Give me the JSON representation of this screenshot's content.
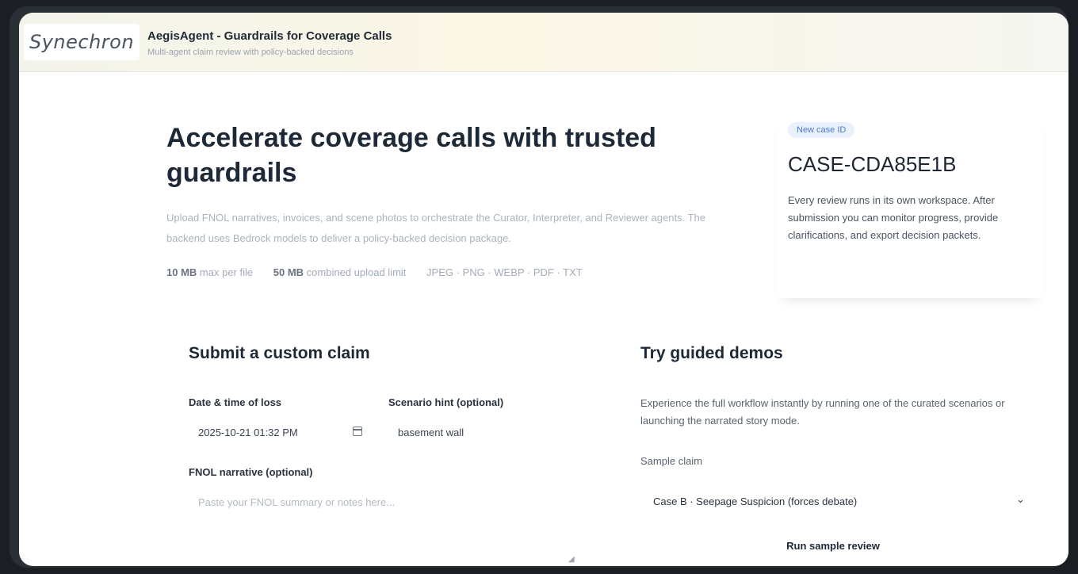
{
  "header": {
    "logo_text": "Synechron",
    "title": "AegisAgent - Guardrails for Coverage Calls",
    "subtitle": "Multi-agent claim review with policy-backed decisions"
  },
  "hero": {
    "title": "Accelerate coverage calls with trusted guardrails",
    "description": "Upload FNOL narratives, invoices, and scene photos to orchestrate the Curator, Interpreter, and Reviewer agents. The backend uses Bedrock models to deliver a policy-backed decision package.",
    "limit_file_value": "10 MB",
    "limit_file_text": "max per file",
    "limit_total_value": "50 MB",
    "limit_total_text": "combined upload limit",
    "formats": "JPEG · PNG · WEBP · PDF · TXT"
  },
  "case": {
    "badge": "New case ID",
    "id": "CASE-CDA85E1B",
    "description": "Every review runs in its own workspace. After submission you can monitor progress, provide clarifications, and export decision packets."
  },
  "custom_claim": {
    "title": "Submit a custom claim",
    "date_label": "Date & time of loss",
    "date_value": "2025-10-21 01:32 PM",
    "scenario_label": "Scenario hint (optional)",
    "scenario_value": "basement wall",
    "fnol_label": "FNOL narrative (optional)",
    "fnol_placeholder": "Paste your FNOL summary or notes here..."
  },
  "demos": {
    "title": "Try guided demos",
    "description": "Experience the full workflow instantly by running one of the curated scenarios or launching the narrated story mode.",
    "sample_label": "Sample claim",
    "sample_selected": "Case B · Seepage Suspicion (forces debate)",
    "run_button": "Run sample review"
  },
  "icons": {
    "calendar": "calendar-icon",
    "chevron": "chevron-down-icon",
    "resize": "resize-handle-icon"
  },
  "colors": {
    "badge_text": "#4a7ad0",
    "badge_bg": "#eaf1fd",
    "heading": "#1e2937"
  }
}
